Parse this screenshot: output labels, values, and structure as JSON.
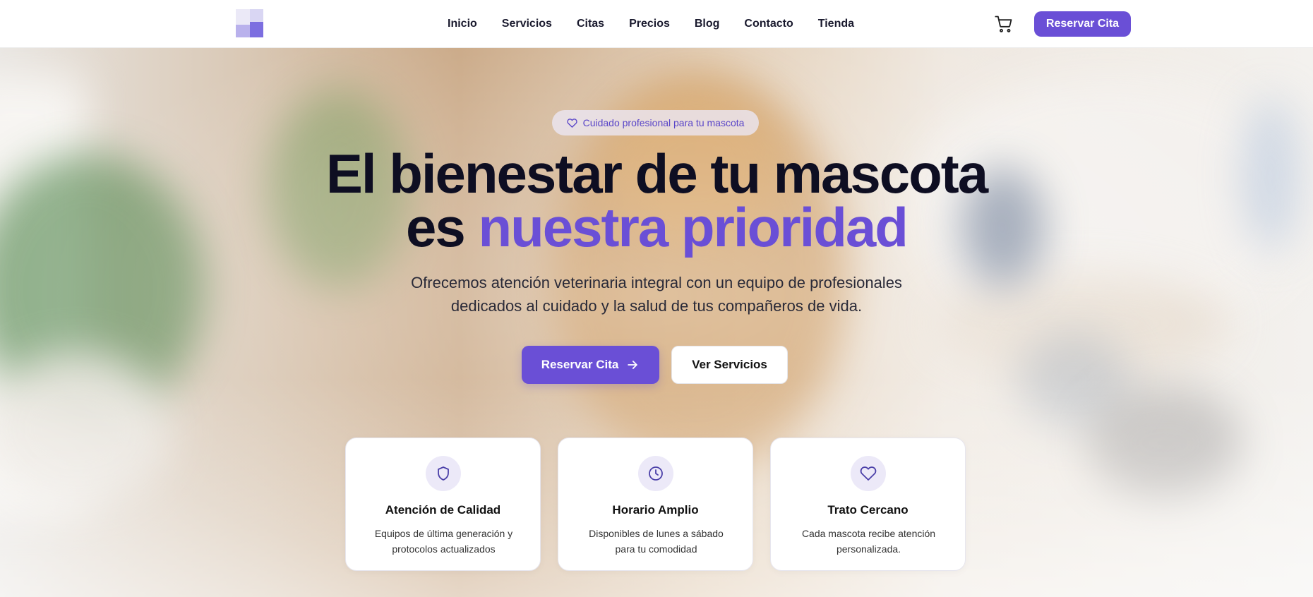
{
  "nav": {
    "links": [
      "Inicio",
      "Servicios",
      "Citas",
      "Precios",
      "Blog",
      "Contacto",
      "Tienda"
    ],
    "cta_label": "Reservar Cita"
  },
  "hero": {
    "badge": "Cuidado profesional para tu mascota",
    "headline_line1": "El bienestar de tu mascota",
    "headline_line2_plain": "es",
    "headline_line2_accent": "nuestra prioridad",
    "subtitle": "Ofrecemos atención veterinaria integral con un equipo de profesionales dedicados al cuidado y la salud de tus compañeros de vida.",
    "primary_cta": "Reservar Cita",
    "secondary_cta": "Ver Servicios"
  },
  "features": [
    {
      "icon": "shield-icon",
      "title": "Atención de Calidad",
      "text": "Equipos de última generación y protocolos actualizados"
    },
    {
      "icon": "clock-icon",
      "title": "Horario Amplio",
      "text": "Disponibles de lunes a sábado para tu comodidad"
    },
    {
      "icon": "heart-icon",
      "title": "Trato Cercano",
      "text": "Cada mascota recibe atención personalizada."
    }
  ],
  "colors": {
    "accent": "#6a4fd6",
    "dark": "#0e0e22",
    "icon_bg": "#ece9f8"
  }
}
